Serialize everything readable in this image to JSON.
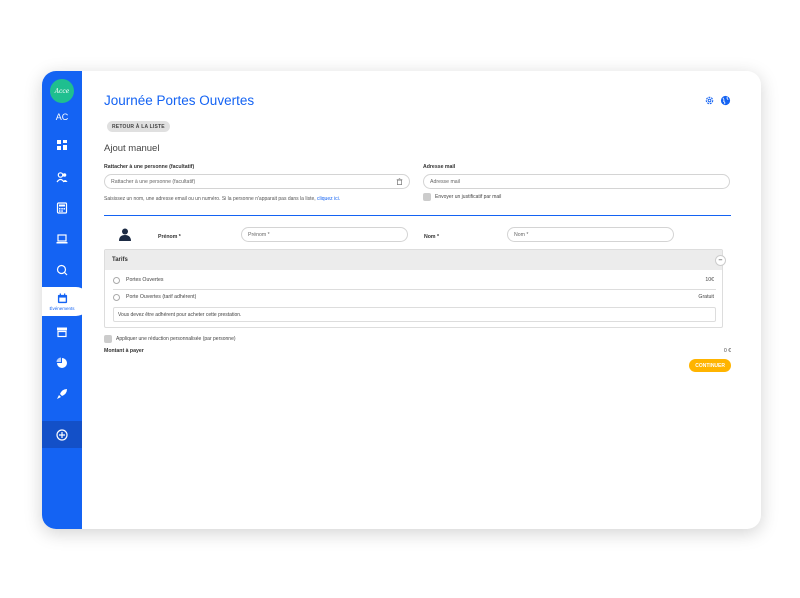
{
  "sidebar": {
    "logo_text": "Acce",
    "initials": "AC",
    "active_label": "Événements",
    "icons": [
      "dashboard-icon",
      "users-icon",
      "calculator-icon",
      "laptop-icon",
      "chat-icon",
      "calendar-icon",
      "store-icon",
      "pie-icon",
      "rocket-icon",
      "plus-circle-icon"
    ]
  },
  "header": {
    "title": "Journée Portes Ouvertes",
    "back_label": "RETOUR À LA LISTE",
    "settings_icon": "gear-icon",
    "globe_icon": "globe-icon"
  },
  "form": {
    "section_title": "Ajout manuel",
    "link_person_label": "Rattacher à une personne (facultatif)",
    "link_person_placeholder": "Rattacher à une personne (facultatif)",
    "email_label": "Adresse mail",
    "email_placeholder": "Adresse mail",
    "hint_text": "Saisissez un nom, une adresse email ou un numéro. Si la personne n'apparait pas dans la liste,",
    "hint_link": "cliquez ici.",
    "send_receipt_label": "Envoyer un justificatif par mail",
    "firstname_label": "Prénom *",
    "firstname_placeholder": "Prénom *",
    "lastname_label": "Nom *",
    "lastname_placeholder": "Nom *"
  },
  "tarifs": {
    "title": "Tarifs",
    "collapse": "–",
    "options": [
      {
        "label": "Portes Ouvertes",
        "price": "10€"
      },
      {
        "label": "Porte Ouvertes (tarif adhérent)",
        "price": "Gratuit"
      }
    ],
    "notice": "Vous devez être adhérent pour acheter cette prestation."
  },
  "discount_label": "Appliquer une réduction personnalisée (par personne)",
  "payment": {
    "amount_label": "Montant à payer",
    "amount_value": "0 €",
    "continue_label": "CONTINUER"
  },
  "colors": {
    "primary": "#1463f3",
    "accent": "#ffb400",
    "logo": "#1fbf8f"
  }
}
